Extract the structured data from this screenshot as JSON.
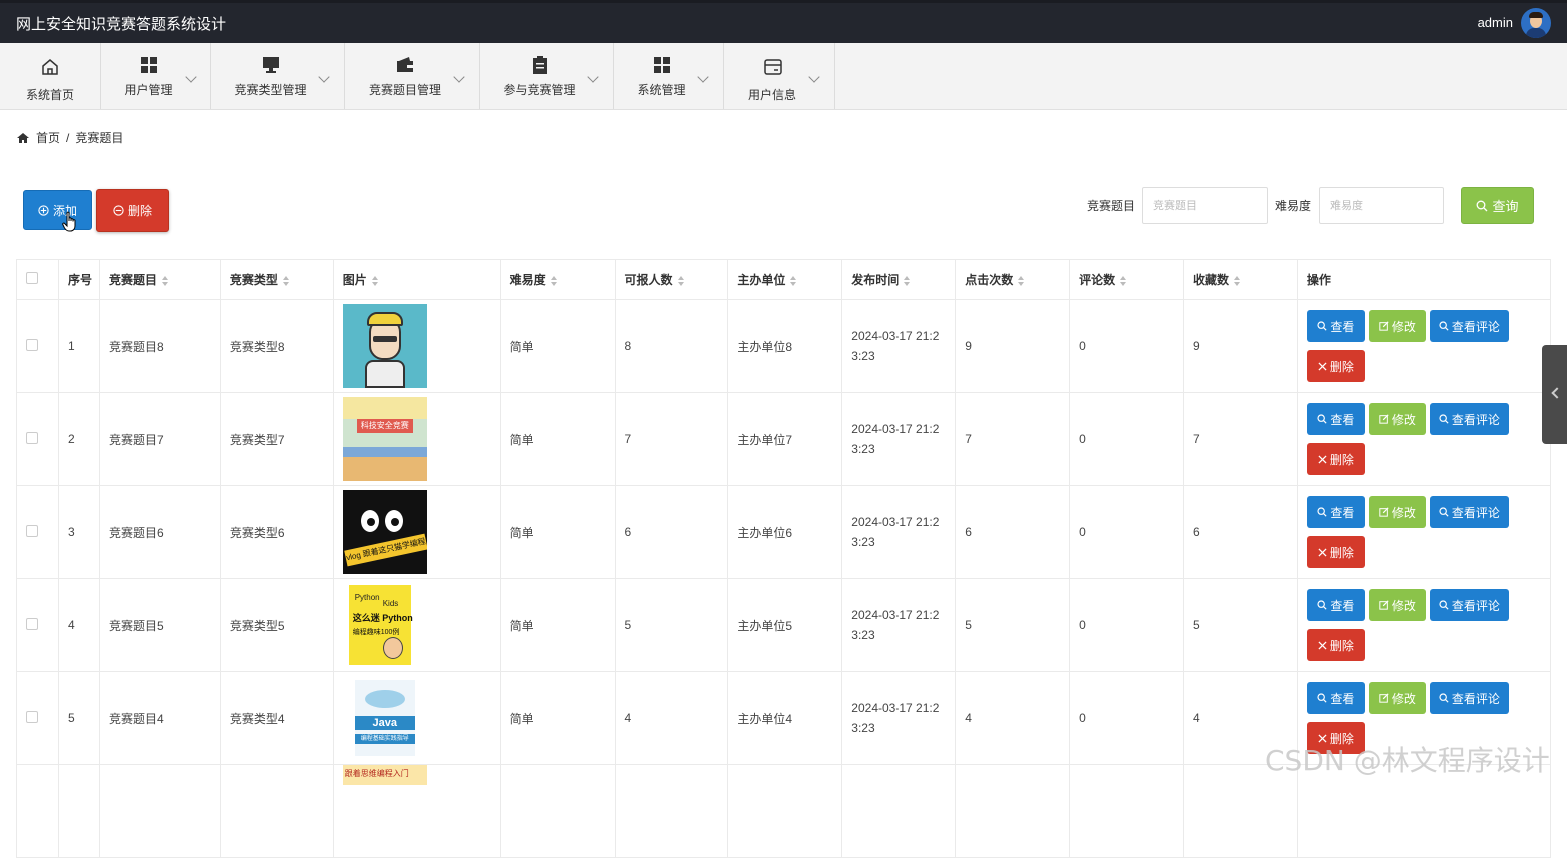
{
  "header": {
    "title": "网上安全知识竞赛答题系统设计",
    "user": "admin"
  },
  "nav": [
    {
      "label": "系统首页",
      "icon": "home-icon"
    },
    {
      "label": "用户管理",
      "icon": "grid-icon"
    },
    {
      "label": "竞赛类型管理",
      "icon": "monitor-icon"
    },
    {
      "label": "竞赛题目管理",
      "icon": "wallet-icon"
    },
    {
      "label": "参与竞赛管理",
      "icon": "clipboard-icon"
    },
    {
      "label": "系统管理",
      "icon": "grid-icon"
    },
    {
      "label": "用户信息",
      "icon": "card-icon"
    }
  ],
  "breadcrumb": {
    "home": "首页",
    "sep": "/",
    "current": "竞赛题目"
  },
  "toolbar": {
    "add_label": "添加",
    "delete_label": "删除",
    "query_label": "查询"
  },
  "search": {
    "field1_label": "竞赛题目",
    "field1_placeholder": "竞赛题目",
    "field2_label": "难易度",
    "field2_placeholder": "难易度"
  },
  "table": {
    "headers": [
      "序号",
      "竞赛题目",
      "竞赛类型",
      "图片",
      "难易度",
      "可报人数",
      "主办单位",
      "发布时间",
      "点击次数",
      "评论数",
      "收藏数",
      "操作"
    ],
    "rows": [
      {
        "no": "1",
        "title": "竞赛题目8",
        "type": "竞赛类型8",
        "difficulty": "简单",
        "quota": "8",
        "org": "主办单位8",
        "time": "2024-03-17 21:2 3:23",
        "clicks": "9",
        "comments": "0",
        "favs": "9"
      },
      {
        "no": "2",
        "title": "竞赛题目7",
        "type": "竞赛类型7",
        "difficulty": "简单",
        "quota": "7",
        "org": "主办单位7",
        "time": "2024-03-17 21:2 3:23",
        "clicks": "7",
        "comments": "0",
        "favs": "7"
      },
      {
        "no": "3",
        "title": "竞赛题目6",
        "type": "竞赛类型6",
        "difficulty": "简单",
        "quota": "6",
        "org": "主办单位6",
        "time": "2024-03-17 21:2 3:23",
        "clicks": "6",
        "comments": "0",
        "favs": "6"
      },
      {
        "no": "4",
        "title": "竞赛题目5",
        "type": "竞赛类型5",
        "difficulty": "简单",
        "quota": "5",
        "org": "主办单位5",
        "time": "2024-03-17 21:2 3:23",
        "clicks": "5",
        "comments": "0",
        "favs": "5"
      },
      {
        "no": "5",
        "title": "竞赛题目4",
        "type": "竞赛类型4",
        "difficulty": "简单",
        "quota": "4",
        "org": "主办单位4",
        "time": "2024-03-17 21:2 3:23",
        "clicks": "4",
        "comments": "0",
        "favs": "4"
      }
    ],
    "ops": {
      "view": "查看",
      "edit": "修改",
      "comment": "查看评论",
      "delete": "删除"
    }
  },
  "thumb_text": {
    "t2": "科技安全竞赛",
    "t3": "vlog 跟着这只猫学编程",
    "t4a": "Python",
    "t4b": "Kids",
    "t4c": "这么迷 Python",
    "t4d": "编程趣味100例",
    "t5a": "Java",
    "t5b": "编程基础实践指导",
    "t6": "跟着思维编程入门"
  },
  "watermark": "CSDN @林文程序设计"
}
